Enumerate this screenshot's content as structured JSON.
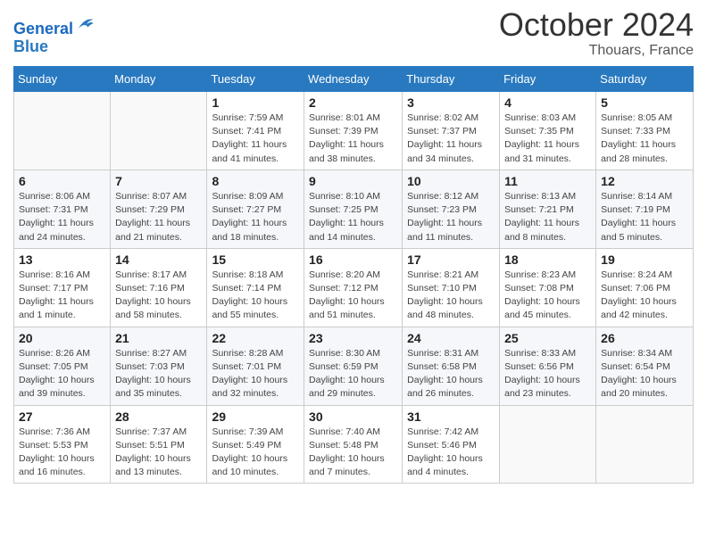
{
  "header": {
    "logo": {
      "line1": "General",
      "line2": "Blue"
    },
    "month": "October 2024",
    "location": "Thouars, France"
  },
  "days_of_week": [
    "Sunday",
    "Monday",
    "Tuesday",
    "Wednesday",
    "Thursday",
    "Friday",
    "Saturday"
  ],
  "weeks": [
    [
      {
        "day": "",
        "info": ""
      },
      {
        "day": "",
        "info": ""
      },
      {
        "day": "1",
        "info": "Sunrise: 7:59 AM\nSunset: 7:41 PM\nDaylight: 11 hours and 41 minutes."
      },
      {
        "day": "2",
        "info": "Sunrise: 8:01 AM\nSunset: 7:39 PM\nDaylight: 11 hours and 38 minutes."
      },
      {
        "day": "3",
        "info": "Sunrise: 8:02 AM\nSunset: 7:37 PM\nDaylight: 11 hours and 34 minutes."
      },
      {
        "day": "4",
        "info": "Sunrise: 8:03 AM\nSunset: 7:35 PM\nDaylight: 11 hours and 31 minutes."
      },
      {
        "day": "5",
        "info": "Sunrise: 8:05 AM\nSunset: 7:33 PM\nDaylight: 11 hours and 28 minutes."
      }
    ],
    [
      {
        "day": "6",
        "info": "Sunrise: 8:06 AM\nSunset: 7:31 PM\nDaylight: 11 hours and 24 minutes."
      },
      {
        "day": "7",
        "info": "Sunrise: 8:07 AM\nSunset: 7:29 PM\nDaylight: 11 hours and 21 minutes."
      },
      {
        "day": "8",
        "info": "Sunrise: 8:09 AM\nSunset: 7:27 PM\nDaylight: 11 hours and 18 minutes."
      },
      {
        "day": "9",
        "info": "Sunrise: 8:10 AM\nSunset: 7:25 PM\nDaylight: 11 hours and 14 minutes."
      },
      {
        "day": "10",
        "info": "Sunrise: 8:12 AM\nSunset: 7:23 PM\nDaylight: 11 hours and 11 minutes."
      },
      {
        "day": "11",
        "info": "Sunrise: 8:13 AM\nSunset: 7:21 PM\nDaylight: 11 hours and 8 minutes."
      },
      {
        "day": "12",
        "info": "Sunrise: 8:14 AM\nSunset: 7:19 PM\nDaylight: 11 hours and 5 minutes."
      }
    ],
    [
      {
        "day": "13",
        "info": "Sunrise: 8:16 AM\nSunset: 7:17 PM\nDaylight: 11 hours and 1 minute."
      },
      {
        "day": "14",
        "info": "Sunrise: 8:17 AM\nSunset: 7:16 PM\nDaylight: 10 hours and 58 minutes."
      },
      {
        "day": "15",
        "info": "Sunrise: 8:18 AM\nSunset: 7:14 PM\nDaylight: 10 hours and 55 minutes."
      },
      {
        "day": "16",
        "info": "Sunrise: 8:20 AM\nSunset: 7:12 PM\nDaylight: 10 hours and 51 minutes."
      },
      {
        "day": "17",
        "info": "Sunrise: 8:21 AM\nSunset: 7:10 PM\nDaylight: 10 hours and 48 minutes."
      },
      {
        "day": "18",
        "info": "Sunrise: 8:23 AM\nSunset: 7:08 PM\nDaylight: 10 hours and 45 minutes."
      },
      {
        "day": "19",
        "info": "Sunrise: 8:24 AM\nSunset: 7:06 PM\nDaylight: 10 hours and 42 minutes."
      }
    ],
    [
      {
        "day": "20",
        "info": "Sunrise: 8:26 AM\nSunset: 7:05 PM\nDaylight: 10 hours and 39 minutes."
      },
      {
        "day": "21",
        "info": "Sunrise: 8:27 AM\nSunset: 7:03 PM\nDaylight: 10 hours and 35 minutes."
      },
      {
        "day": "22",
        "info": "Sunrise: 8:28 AM\nSunset: 7:01 PM\nDaylight: 10 hours and 32 minutes."
      },
      {
        "day": "23",
        "info": "Sunrise: 8:30 AM\nSunset: 6:59 PM\nDaylight: 10 hours and 29 minutes."
      },
      {
        "day": "24",
        "info": "Sunrise: 8:31 AM\nSunset: 6:58 PM\nDaylight: 10 hours and 26 minutes."
      },
      {
        "day": "25",
        "info": "Sunrise: 8:33 AM\nSunset: 6:56 PM\nDaylight: 10 hours and 23 minutes."
      },
      {
        "day": "26",
        "info": "Sunrise: 8:34 AM\nSunset: 6:54 PM\nDaylight: 10 hours and 20 minutes."
      }
    ],
    [
      {
        "day": "27",
        "info": "Sunrise: 7:36 AM\nSunset: 5:53 PM\nDaylight: 10 hours and 16 minutes."
      },
      {
        "day": "28",
        "info": "Sunrise: 7:37 AM\nSunset: 5:51 PM\nDaylight: 10 hours and 13 minutes."
      },
      {
        "day": "29",
        "info": "Sunrise: 7:39 AM\nSunset: 5:49 PM\nDaylight: 10 hours and 10 minutes."
      },
      {
        "day": "30",
        "info": "Sunrise: 7:40 AM\nSunset: 5:48 PM\nDaylight: 10 hours and 7 minutes."
      },
      {
        "day": "31",
        "info": "Sunrise: 7:42 AM\nSunset: 5:46 PM\nDaylight: 10 hours and 4 minutes."
      },
      {
        "day": "",
        "info": ""
      },
      {
        "day": "",
        "info": ""
      }
    ]
  ]
}
